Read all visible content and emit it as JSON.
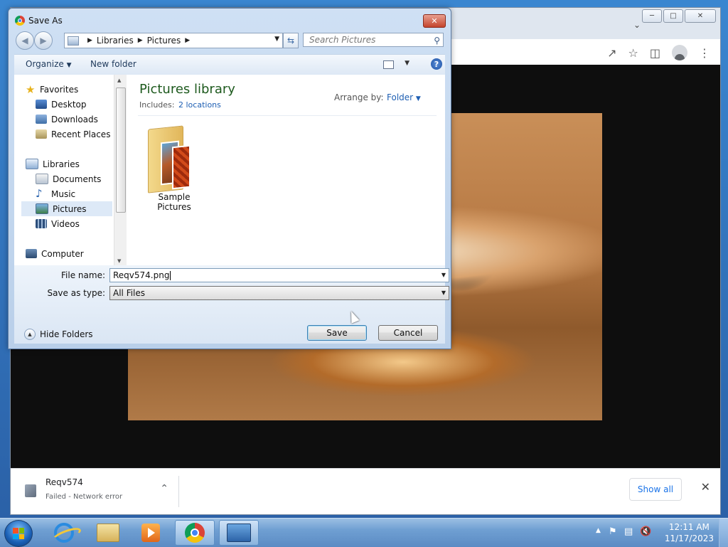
{
  "chrome": {
    "download": {
      "filename": "Reqv574",
      "status": "Failed - Network error",
      "show_all": "Show all"
    }
  },
  "dialog": {
    "title": "Save As",
    "breadcrumb": [
      "Libraries",
      "Pictures"
    ],
    "search_placeholder": "Search Pictures",
    "toolbar": {
      "organize": "Organize",
      "new_folder": "New folder"
    },
    "nav_pane": {
      "favorites": "Favorites",
      "desktop": "Desktop",
      "downloads": "Downloads",
      "recent_places": "Recent Places",
      "libraries": "Libraries",
      "documents": "Documents",
      "music": "Music",
      "pictures": "Pictures",
      "videos": "Videos",
      "computer": "Computer"
    },
    "library": {
      "title": "Pictures library",
      "includes_label": "Includes:",
      "locations": "2 locations",
      "arrange_label": "Arrange by:",
      "arrange_value": "Folder"
    },
    "items": [
      {
        "name": "Sample Pictures"
      }
    ],
    "file_name_label": "File name:",
    "file_name_value": "Reqv574.png",
    "save_type_label": "Save as type:",
    "save_type_value": "All Files",
    "hide_folders": "Hide Folders",
    "save_button": "Save",
    "cancel_button": "Cancel"
  },
  "taskbar": {
    "time": "12:11 AM",
    "date": "11/17/2023"
  },
  "colors": {
    "library_title": "#1e5a1e",
    "link": "#1e5fb3",
    "chrome_link": "#1a73e8"
  }
}
